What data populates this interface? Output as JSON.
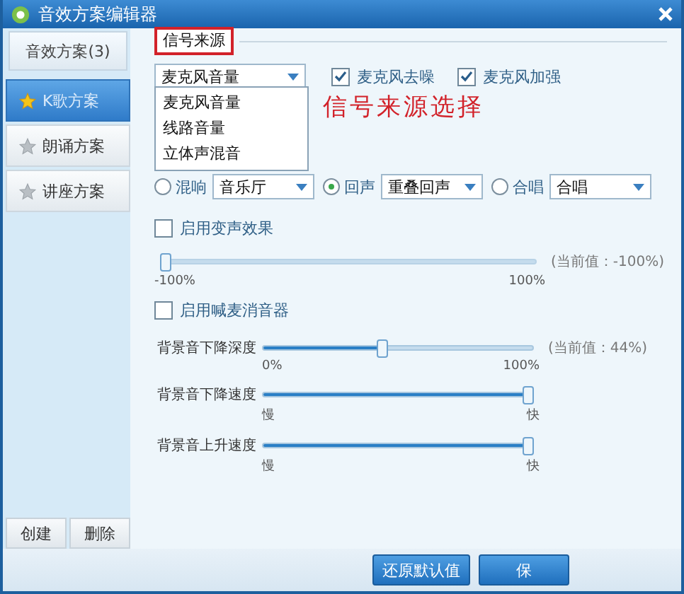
{
  "window": {
    "title": "音效方案编辑器"
  },
  "sidebar": {
    "header": "音效方案(3)",
    "items": [
      {
        "label": "K歌方案",
        "selected": true
      },
      {
        "label": "朗诵方案",
        "selected": false
      },
      {
        "label": "讲座方案",
        "selected": false
      }
    ],
    "buttons": [
      "创建",
      "删除"
    ]
  },
  "signal": {
    "title": "信号来源",
    "source": "麦克风音量",
    "options": [
      "麦克风音量",
      "线路音量",
      "立体声混音"
    ],
    "checkboxes": [
      {
        "label": "麦克风去噪",
        "checked": true
      },
      {
        "label": "麦克风加强",
        "checked": true
      }
    ],
    "annotation": "信号来源选择"
  },
  "effects": [
    {
      "label": "混响",
      "selected": false,
      "value": "音乐厅"
    },
    {
      "label": "回声",
      "selected": true,
      "value": "重叠回声"
    },
    {
      "label": "合唱",
      "selected": false,
      "value": "合唱"
    }
  ],
  "voice_change": {
    "label": "启用变声效果",
    "checked": false,
    "level": 0,
    "min": "-100%",
    "max": "100%",
    "reading": "(当前值：-100%)"
  },
  "muter": {
    "label": "启用喊麦消音器",
    "checked": false
  },
  "background": [
    {
      "label": "背景音下降深度",
      "level": 0.44,
      "min": "0%",
      "max": "100%",
      "reading": "(当前值：44%)"
    },
    {
      "label": "背景音下降速度",
      "level": 1,
      "min": "慢",
      "max": "快"
    },
    {
      "label": "背景音上升速度",
      "level": 1,
      "min": "慢",
      "max": "快"
    }
  ],
  "footer_buttons": [
    "还原默认值",
    "保"
  ]
}
